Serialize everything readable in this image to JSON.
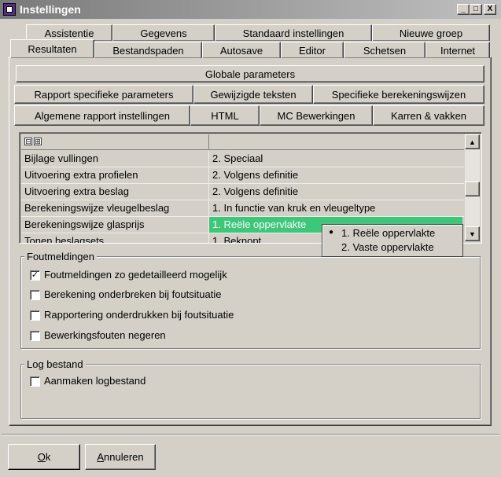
{
  "window": {
    "title": "Instellingen",
    "controls": [
      "_",
      "□",
      "X"
    ]
  },
  "tabs_row1": [
    "Assistentie",
    "Gegevens",
    "Standaard instellingen",
    "Nieuwe groep"
  ],
  "tabs_row2": [
    "Resultaten",
    "Bestandspaden",
    "Autosave",
    "Editor",
    "Schetsen",
    "Internet"
  ],
  "subtabs": {
    "row1": [
      "Globale parameters"
    ],
    "row2": [
      "Rapport specifieke parameters",
      "Gewijzigde teksten",
      "Specifieke berekeningswijzen"
    ],
    "row3": [
      "Algemene rapport instellingen",
      "HTML",
      "MC Bewerkingen",
      "Karren & vakken"
    ]
  },
  "grid": {
    "header_icons": [
      "⊟",
      "⊞"
    ],
    "rows": [
      {
        "name": "Bijlage vullingen",
        "value": "2. Speciaal"
      },
      {
        "name": "Uitvoering extra profielen",
        "value": "2. Volgens definitie"
      },
      {
        "name": "Uitvoering extra beslag",
        "value": "2. Volgens definitie"
      },
      {
        "name": "Berekeningswijze vleugelbeslag",
        "value": "1. In functie van kruk en vleugeltype"
      },
      {
        "name": "Berekeningswijze glasprijs",
        "value": "1. Reële oppervlakte"
      },
      {
        "name": "Tonen beslagsets",
        "value": "1. Beknopt"
      }
    ],
    "dropdown_options": [
      "1. Reële oppervlakte",
      "2. Vaste oppervlakte"
    ],
    "dropdown_selected_marker": "●"
  },
  "foutmeldingen": {
    "title": "Foutmeldingen",
    "items": [
      {
        "label": "Foutmeldingen zo gedetailleerd mogelijk",
        "checked": true
      },
      {
        "label": "Berekening onderbreken bij foutsituatie",
        "checked": false
      },
      {
        "label": "Rapportering onderdrukken bij foutsituatie",
        "checked": false
      },
      {
        "label": "Bewerkingsfouten negeren",
        "checked": false
      }
    ]
  },
  "logbestand": {
    "title": "Log bestand",
    "items": [
      {
        "label": "Aanmaken logbestand",
        "checked": false
      }
    ]
  },
  "buttons": {
    "ok_first": "O",
    "ok_rest": "k",
    "cancel_first": "A",
    "cancel_rest": "nnuleren"
  },
  "colors": {
    "dialog": "#d4d0c8",
    "selection": "#3cc878"
  }
}
